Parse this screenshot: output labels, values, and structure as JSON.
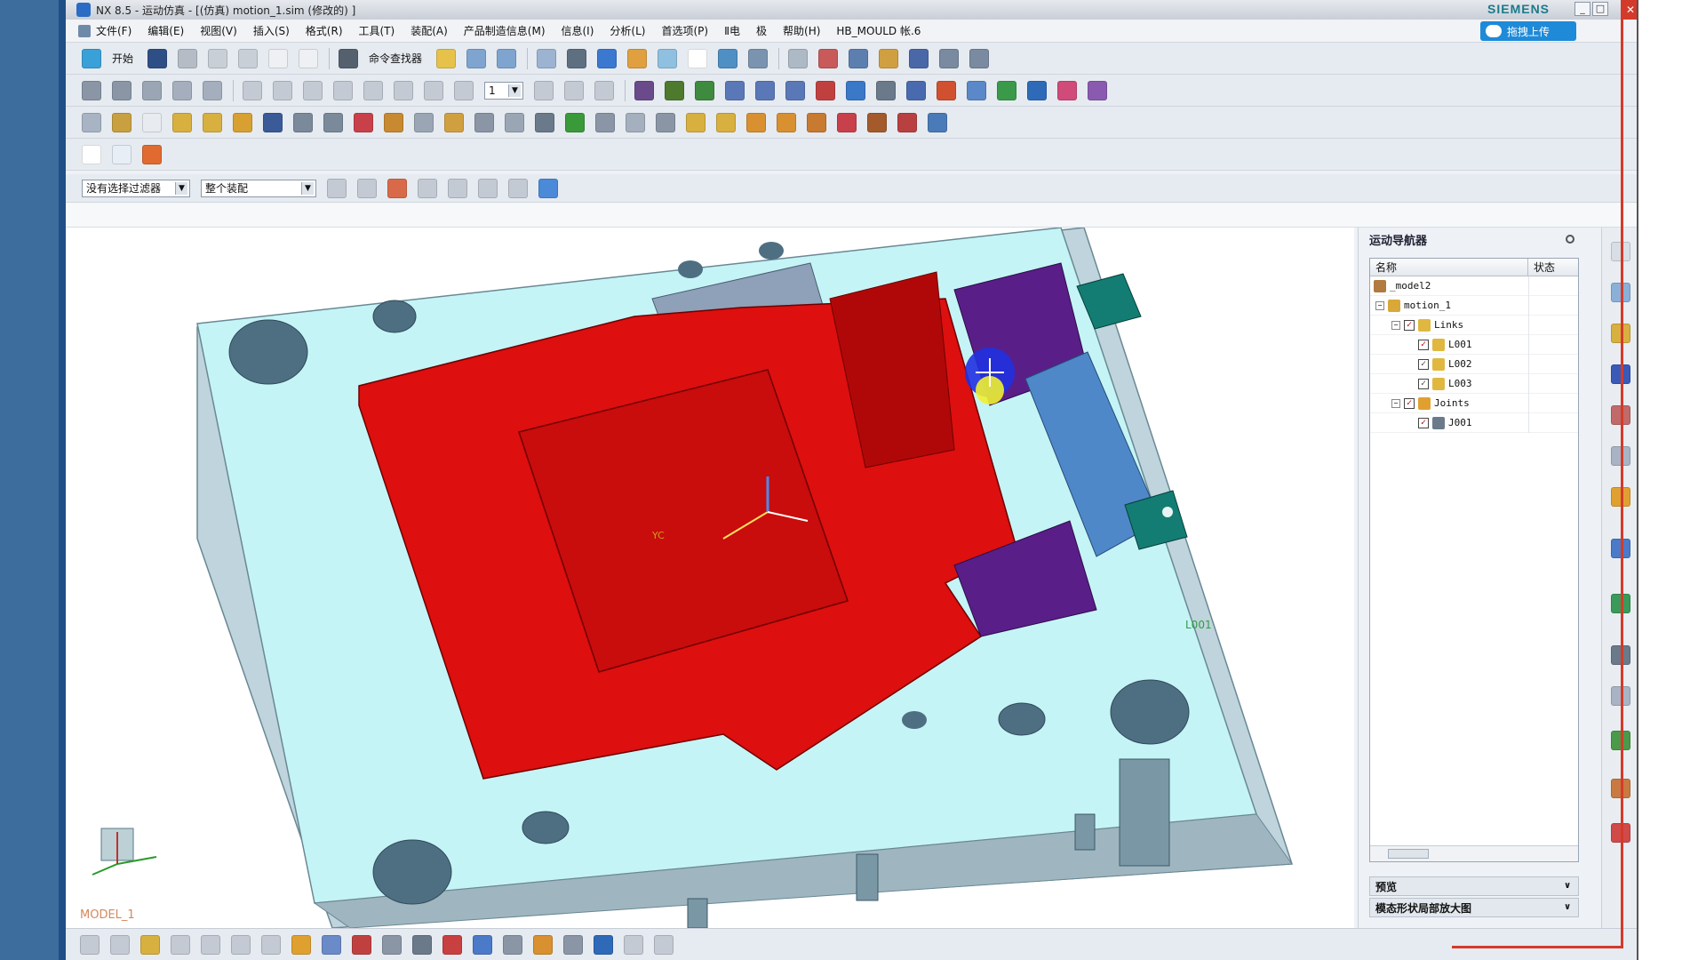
{
  "window": {
    "title": "NX 8.5 - 运动仿真 - [(仿真) motion_1.sim (修改的) ]",
    "brand": "SIEMENS"
  },
  "menu": {
    "items": [
      "文件(F)",
      "编辑(E)",
      "视图(V)",
      "插入(S)",
      "格式(R)",
      "工具(T)",
      "装配(A)",
      "产品制造信息(M)",
      "信息(I)",
      "分析(L)",
      "首选项(P)",
      "Ⅱ电",
      "极",
      "帮助(H)",
      "HB_MOULD 帐.6"
    ]
  },
  "cloud": {
    "label": "拖拽上传"
  },
  "toolbar": {
    "start_label": "开始",
    "cmd_finder_label": "命令查找器",
    "frame_value": "1"
  },
  "selection_bar": {
    "filter_value": "没有选择过滤器",
    "scope_value": "整个装配"
  },
  "viewport": {
    "model_name": "MODEL_1",
    "link_label": "L001",
    "wcs_label": "YC"
  },
  "navigator": {
    "title": "运动导航器",
    "col_name": "名称",
    "col_state": "状态",
    "rows": [
      {
        "label": "_model2"
      },
      {
        "label": "motion_1"
      },
      {
        "label": "Links"
      },
      {
        "label": "L001"
      },
      {
        "label": "L002"
      },
      {
        "label": "L003"
      },
      {
        "label": "Joints"
      },
      {
        "label": "J001"
      }
    ],
    "section_preview": "预览",
    "section_view": "模态形状局部放大图"
  },
  "colors": {
    "cavity_red": "#dd0f0f",
    "plate_cyan": "#c5f4f6",
    "slider_purple": "#5a1e88",
    "guide_teal": "#137d74",
    "accent_blue": "#1e8ad8"
  }
}
